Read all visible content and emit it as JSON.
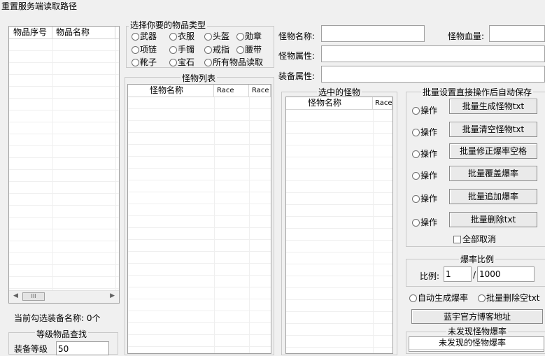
{
  "window": {
    "title": "重置服务端读取路径"
  },
  "item_list": {
    "col_index": "物品序号",
    "col_name": "物品名称",
    "scroll_thumb": "III",
    "status_text": "当前勾选装备名称: 0个"
  },
  "level_search": {
    "title": "等级物品查找",
    "label": "装备等级",
    "value": "50"
  },
  "item_type": {
    "title": "选择你要的物品类型",
    "options": [
      "武器",
      "衣服",
      "头盔",
      "勋章",
      "项链",
      "手镯",
      "戒指",
      "腰带",
      "靴子",
      "宝石",
      "所有物品读取"
    ]
  },
  "monster_list": {
    "title": "怪物列表",
    "col_name": "怪物名称",
    "col_race1": "Race",
    "col_race2": "Race"
  },
  "form": {
    "monster_name_label": "怪物名称:",
    "monster_hp_label": "怪物血量:",
    "monster_attr_label": "怪物属性:",
    "equip_attr_label": "装备属性:"
  },
  "selected": {
    "title": "选中的怪物",
    "col_name": "怪物名称",
    "col_race": "Race"
  },
  "batch": {
    "title": "批量设置直接操作后自动保存",
    "radio_label": "操作",
    "buttons": [
      "批量生成怪物txt",
      "批量清空怪物txt",
      "批量修正爆率空格",
      "批量覆盖爆率",
      "批量追加爆率",
      "批量删除txt"
    ],
    "cancel_all": "全部取消"
  },
  "rate": {
    "title": "爆率比例",
    "label": "比例:",
    "numerator": "1",
    "separator": "/",
    "denominator": "1000",
    "auto_generate": "自动生成爆率",
    "batch_delete_empty": "批量删除空txt"
  },
  "blog_button": "蓝宇官方博客地址",
  "undiscovered": {
    "title": "未发现怪物爆率",
    "col_name": "未发现的怪物爆率"
  }
}
